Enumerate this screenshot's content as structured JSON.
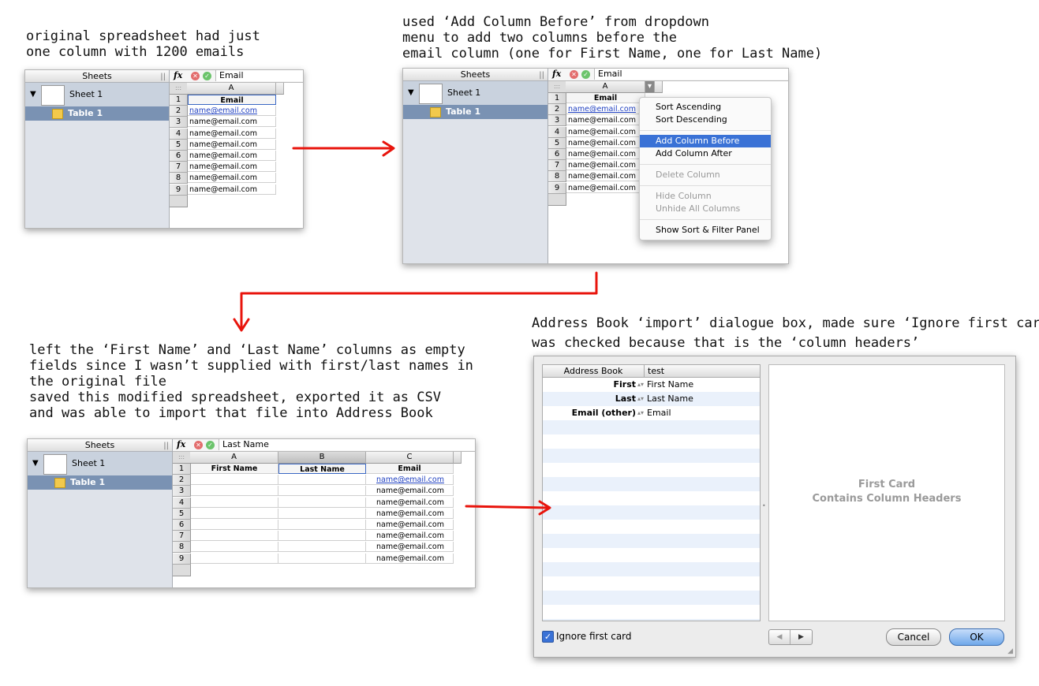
{
  "notes": {
    "n1": "original spreadsheet had just\none column with 1200 emails",
    "n2": "used ‘Add Column Before’ from dropdown\nmenu to add two columns before the\nemail column (one for First Name, one for Last Name)",
    "n3": "left the ‘First Name’ and ‘Last Name’ columns as empty\nfields since I wasn’t supplied with first/last names in\nthe original file\nsaved this modified spreadsheet, exported it as CSV\nand was able to import that file into Address Book",
    "n4": "Address Book ‘import’ dialogue box, made sure ‘Ignore first card’\nwas checked because that is the ‘column headers’"
  },
  "sidebar": {
    "header": "Sheets",
    "sheet": "Sheet 1",
    "table": "Table 1",
    "grip": "||"
  },
  "formula": {
    "fx": "fx",
    "cancel": "✕",
    "accept": "✓"
  },
  "shot1": {
    "formula_value": "Email",
    "col_a": "A",
    "header": "Email",
    "row_numbers": [
      "1",
      "2",
      "3",
      "4",
      "5",
      "6",
      "7",
      "8",
      "9"
    ],
    "emails": [
      "name@email.com",
      "name@email.com",
      "name@email.com",
      "name@email.com",
      "name@email.com",
      "name@email.com",
      "name@email.com",
      "name@email.com"
    ]
  },
  "shot2": {
    "formula_value": "Email",
    "col_a": "A",
    "header": "Email",
    "menu": {
      "sort_asc": "Sort Ascending",
      "sort_desc": "Sort Descending",
      "add_before": "Add Column Before",
      "add_after": "Add Column After",
      "delete": "Delete Column",
      "hide": "Hide Column",
      "unhide": "Unhide All Columns",
      "show_panel": "Show Sort & Filter Panel"
    }
  },
  "shot3": {
    "formula_value": "Last Name",
    "cols": [
      "A",
      "B",
      "C"
    ],
    "headers": [
      "First Name",
      "Last Name",
      "Email"
    ]
  },
  "dialog": {
    "col_left": "Address Book",
    "col_right": "test",
    "rows": [
      {
        "k": "First",
        "v": "First Name"
      },
      {
        "k": "Last",
        "v": "Last Name"
      },
      {
        "k": "Email (other)",
        "v": "Email"
      }
    ],
    "preview_line1": "First Card",
    "preview_line2": "Contains Column Headers",
    "ignore_label": "Ignore first card",
    "ignore_checked": true,
    "nav_prev": "◀",
    "nav_next": "▶",
    "cancel": "Cancel",
    "ok": "OK"
  },
  "colors": {
    "arrow": "#e8140c",
    "accent": "#3a72d6"
  }
}
